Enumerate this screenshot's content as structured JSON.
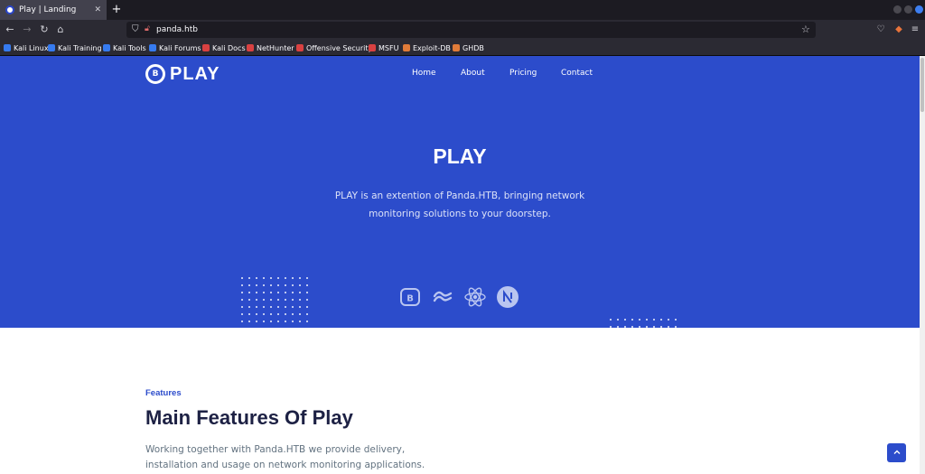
{
  "browser": {
    "tab_title": "Play | Landing",
    "tab_close": "✕",
    "new_tab": "+",
    "url": "panda.htb",
    "bookmarks": [
      {
        "label": "Kali Linux",
        "color": "#367bf0"
      },
      {
        "label": "Kali Training",
        "color": "#367bf0"
      },
      {
        "label": "Kali Tools",
        "color": "#367bf0"
      },
      {
        "label": "Kali Forums",
        "color": "#367bf0"
      },
      {
        "label": "Kali Docs",
        "color": "#d94141"
      },
      {
        "label": "NetHunter",
        "color": "#d94141"
      },
      {
        "label": "Offensive Security",
        "color": "#d94141"
      },
      {
        "label": "MSFU",
        "color": "#d94141"
      },
      {
        "label": "Exploit-DB",
        "color": "#e07b39"
      },
      {
        "label": "GHDB",
        "color": "#e07b39"
      }
    ]
  },
  "site": {
    "logo_text": "PLAY",
    "logo_badge": "B",
    "nav": [
      "Home",
      "About",
      "Pricing",
      "Contact"
    ],
    "hero": {
      "title": "PLAY",
      "subtitle": "PLAY is an extention of Panda.HTB, bringing network monitoring solutions to your doorstep."
    },
    "tech_icons": [
      "bootstrap-icon",
      "tailwind-icon",
      "react-icon",
      "nextjs-icon"
    ],
    "features": {
      "tag": "Features",
      "heading": "Main Features Of Play",
      "text": "Working together with Panda.HTB we provide delivery, installation and usage on network monitoring applications."
    }
  },
  "colors": {
    "brand": "#2c4ccb",
    "heading": "#1d2144",
    "body": "#637381"
  }
}
